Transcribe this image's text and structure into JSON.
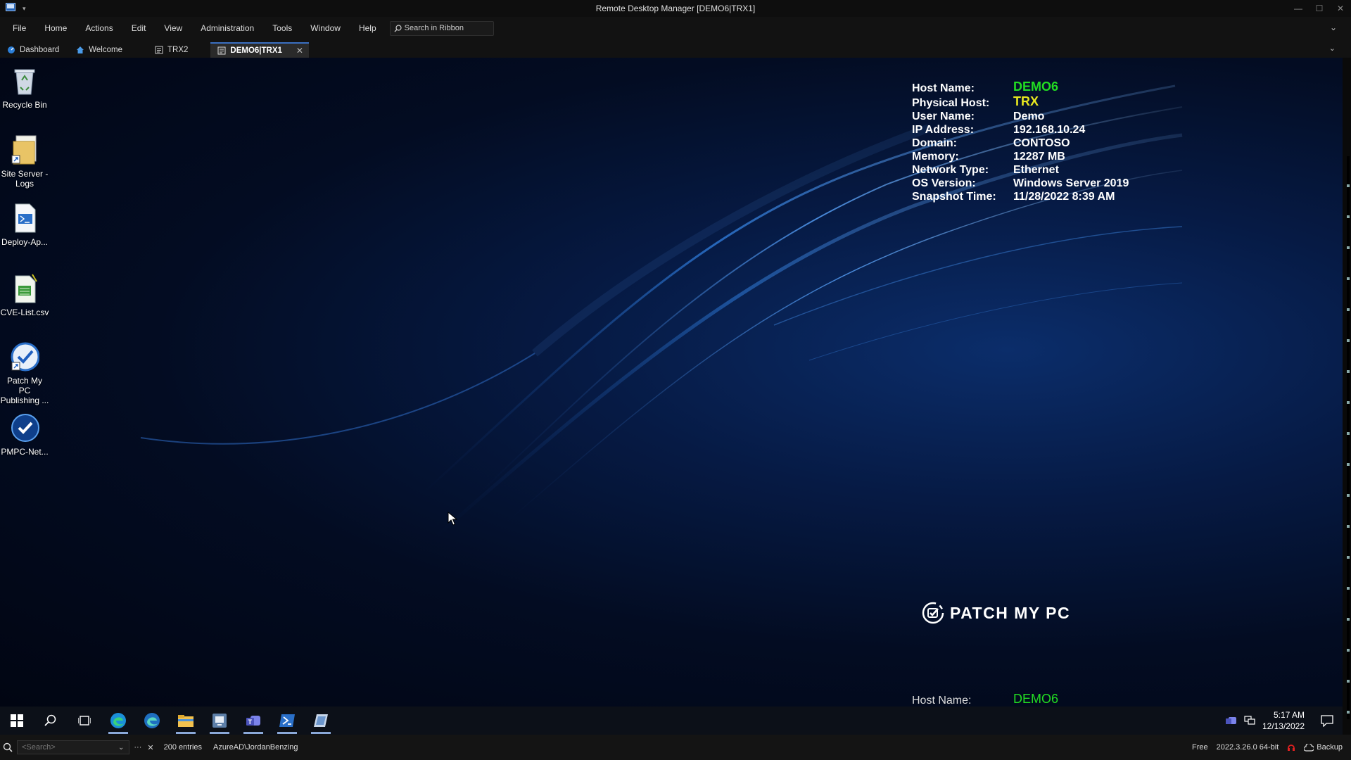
{
  "window": {
    "title": "Remote Desktop Manager [DEMO6|TRX1]"
  },
  "menu": [
    "File",
    "Home",
    "Actions",
    "Edit",
    "View",
    "Administration",
    "Tools",
    "Window",
    "Help"
  ],
  "ribbon_search": {
    "label": "Search in Ribbon"
  },
  "tabs": [
    {
      "label": "Dashboard",
      "icon": "dashboard-icon"
    },
    {
      "label": "Welcome",
      "icon": "home-icon"
    },
    {
      "label": "TRX2",
      "icon": "session-icon"
    },
    {
      "label": "DEMO6|TRX1",
      "icon": "session-icon",
      "active": true
    }
  ],
  "desktop_icons": [
    {
      "label": "Recycle Bin",
      "icon": "recycle-bin-icon"
    },
    {
      "label": "Site Server - Logs",
      "icon": "folder-shortcut-icon"
    },
    {
      "label": "Deploy-Ap...",
      "icon": "powershell-script-icon"
    },
    {
      "label": "CVE-List.csv",
      "icon": "csv-file-icon"
    },
    {
      "label": "Patch My PC Publishing ...",
      "icon": "patch-my-pc-publisher-icon"
    },
    {
      "label": "PMPC-Net...",
      "icon": "pmpc-shield-icon"
    }
  ],
  "bginfo": {
    "labels": {
      "host_name": "Host Name:",
      "physical_host": "Physical Host:",
      "user_name": "User Name:",
      "ip_address": "IP Address:",
      "domain": "Domain:",
      "memory": "Memory:",
      "network_type": "Network Type:",
      "os_version": "OS Version:",
      "snapshot_time": "Snapshot Time:"
    },
    "values": {
      "host_name": "DEMO6",
      "physical_host": "TRX",
      "user_name": "Demo",
      "ip_address": "192.168.10.24",
      "domain": "CONTOSO",
      "memory": "12287 MB",
      "network_type": "Ethernet",
      "os_version": "Windows Server 2019",
      "snapshot_time": "11/28/2022 8:39 AM"
    },
    "colors": {
      "host": "#22dd22",
      "physical_host": "#e8e820"
    }
  },
  "wallpaper_logo": "PATCH MY PC",
  "taskbar": {
    "buttons": [
      "start-icon",
      "search-icon",
      "task-view-icon",
      "edge-icon",
      "edge-beta-icon",
      "file-explorer-icon",
      "configmgr-console-icon",
      "teams-icon",
      "powershell-icon",
      "rdm-icon"
    ],
    "time": "5:17 AM",
    "date": "12/13/2022"
  },
  "statusbar": {
    "search_placeholder": "<Search>",
    "entries": "200 entries",
    "user": "AzureAD\\JordanBenzing",
    "edition": "Free",
    "version": "2022.3.26.0 64-bit",
    "backup": "Backup"
  }
}
